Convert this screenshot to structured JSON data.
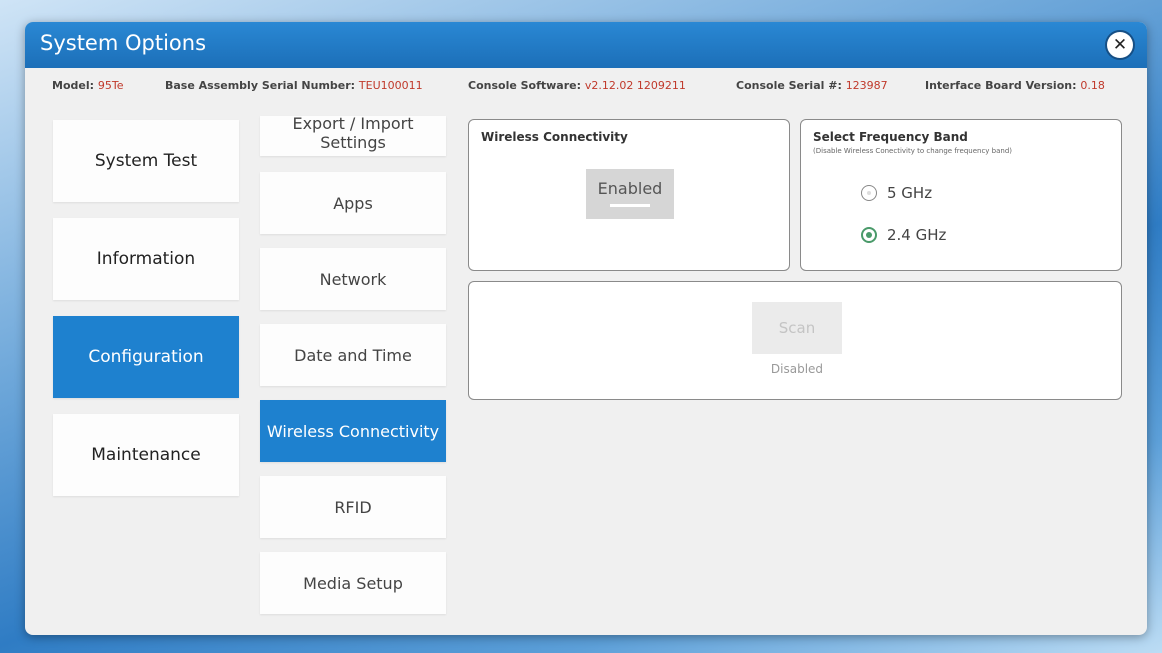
{
  "window": {
    "title": "System Options",
    "close_glyph": "✕"
  },
  "infobar": {
    "model_label": "Model:",
    "model_value": "95Te",
    "base_serial_label": "Base Assembly Serial Number:",
    "base_serial_value": "TEU100011",
    "console_sw_label": "Console Software:",
    "console_sw_value": "v2.12.02 1209211",
    "console_serial_label": "Console Serial #:",
    "console_serial_value": "123987",
    "iface_label": "Interface Board Version:",
    "iface_value": "0.18"
  },
  "nav": {
    "items": [
      {
        "label": "System Test"
      },
      {
        "label": "Information"
      },
      {
        "label": "Configuration",
        "active": true
      },
      {
        "label": "Maintenance"
      }
    ]
  },
  "subnav": {
    "items": [
      {
        "label": "Export / Import Settings"
      },
      {
        "label": "Apps"
      },
      {
        "label": "Network"
      },
      {
        "label": "Date and Time"
      },
      {
        "label": "Wireless Connectivity",
        "active": true
      },
      {
        "label": "RFID"
      },
      {
        "label": "Media Setup"
      }
    ]
  },
  "wireless": {
    "title": "Wireless Connectivity",
    "toggle_label": "Enabled"
  },
  "frequency": {
    "title": "Select Frequency Band",
    "subtitle": "(Disable Wireless Conectivity to change frequency band)",
    "options": [
      {
        "label": "5 GHz",
        "selected": false
      },
      {
        "label": "2.4 GHz",
        "selected": true
      }
    ]
  },
  "scan": {
    "button_label": "Scan",
    "status": "Disabled"
  },
  "colors": {
    "accent": "#1e81cf",
    "value_red": "#c0392b",
    "radio_green": "#4a9a6a"
  }
}
